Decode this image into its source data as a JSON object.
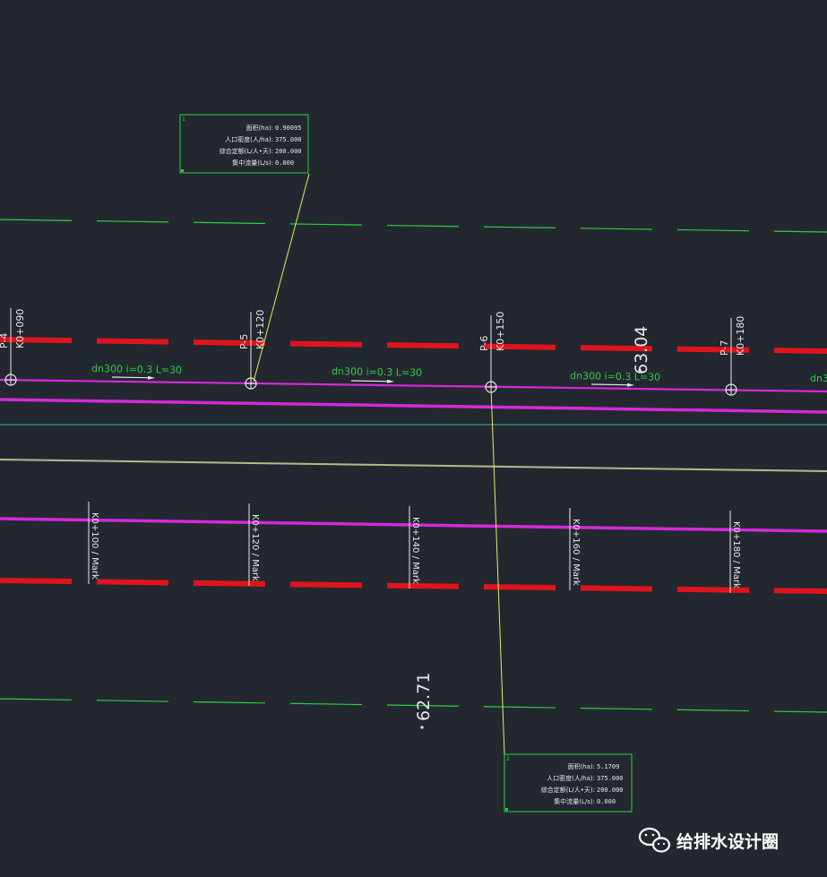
{
  "colors": {
    "background": "#232830",
    "green": "#2ecc40",
    "red": "#e0141c",
    "magenta": "#d42ad8",
    "cyan": "#3fb6b6",
    "olive": "#b9b98a",
    "yellow": "#e8ea62",
    "white": "#e8e8e8"
  },
  "manholes": [
    {
      "id": "P-4",
      "station": "K0+090"
    },
    {
      "id": "P-5",
      "station": "K0+120"
    },
    {
      "id": "P-6",
      "station": "K0+150"
    },
    {
      "id": "P-7",
      "station": "K0+180"
    }
  ],
  "pipe_labels": [
    {
      "text": "dn300  i=0.3  L=30"
    },
    {
      "text": "dn300  i=0.3  L=30"
    },
    {
      "text": "dn300  i=0.3  L=30"
    },
    {
      "text": "dn3"
    }
  ],
  "station_marks": [
    "K0+100 / Mark",
    "K0+120 / Mark",
    "K0+140 / Mark",
    "K0+160 / Mark",
    "K0+180 / Mark"
  ],
  "elevations": [
    "63.04",
    "62.71"
  ],
  "info_boxes": [
    {
      "number": "1",
      "rows": [
        {
          "label": "面积(ha):",
          "value": "0.90095"
        },
        {
          "label": "人口密度(人/ha):",
          "value": "375.000"
        },
        {
          "label": "综合定额(L/人•天):",
          "value": "200.000"
        },
        {
          "label": "集中流量(L/s):",
          "value": "0.000"
        }
      ]
    },
    {
      "number": "2",
      "rows": [
        {
          "label": "面积(ha):",
          "value": "5.1709"
        },
        {
          "label": "人口密度(人/ha):",
          "value": "375.000"
        },
        {
          "label": "综合定额(L/人•天):",
          "value": "200.000"
        },
        {
          "label": "集中流量(L/s):",
          "value": "0.000"
        }
      ]
    }
  ],
  "watermark": {
    "icon": "wechat-icon",
    "text": "给排水设计圈"
  }
}
